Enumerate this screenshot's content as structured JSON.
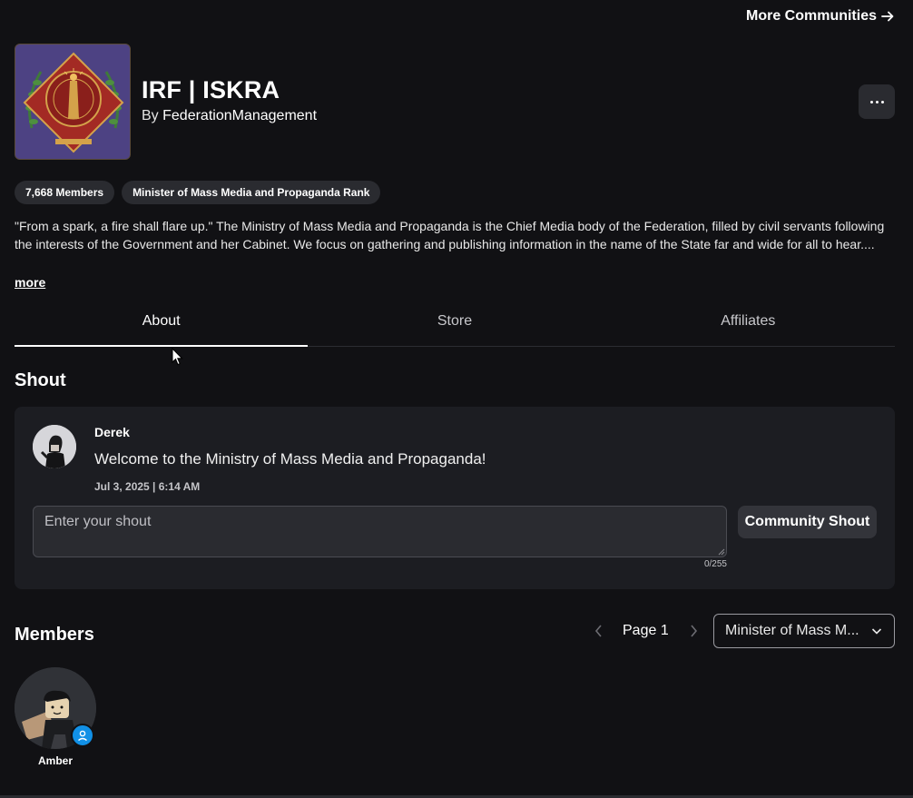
{
  "header": {
    "more_communities": "More Communities"
  },
  "group": {
    "name": "IRF | ISKRA",
    "owner_prefix": "By ",
    "owner_name": "FederationManagement",
    "member_count": "7,668 Members",
    "rank": "Minister of Mass Media and Propaganda Rank",
    "description": "\"From a spark, a fire shall flare up.\" The Ministry of Mass Media and Propaganda is the Chief Media body of the Federation, filled by civil servants following the interests of the Government and her Cabinet. We focus on gathering and publishing information in the name of the State far and wide for all to hear....",
    "more_label": "more"
  },
  "tabs": [
    {
      "label": "About",
      "active": true
    },
    {
      "label": "Store",
      "active": false
    },
    {
      "label": "Affiliates",
      "active": false
    }
  ],
  "shout": {
    "section_title": "Shout",
    "author": "Derek",
    "message": "Welcome to the Ministry of Mass Media and Propaganda!",
    "date": "Jul 3, 2025 | 6:14 AM",
    "input_placeholder": "Enter your shout",
    "char_count": "0/255",
    "button_label": "Community Shout"
  },
  "members": {
    "section_title": "Members",
    "page_label": "Page 1",
    "role_filter": "Minister of Mass M...",
    "list": [
      {
        "name": "Amber"
      }
    ]
  },
  "icons": {
    "more_arrow": "arrow-right-icon",
    "options": "ellipsis-icon",
    "prev": "chevron-left-icon",
    "next": "chevron-right-icon",
    "dropdown": "chevron-down-icon",
    "verified": "person-badge-icon"
  },
  "colors": {
    "background": "#111114",
    "card": "#1c1d22",
    "pill": "#2a2b30",
    "badge": "#1190e6"
  }
}
